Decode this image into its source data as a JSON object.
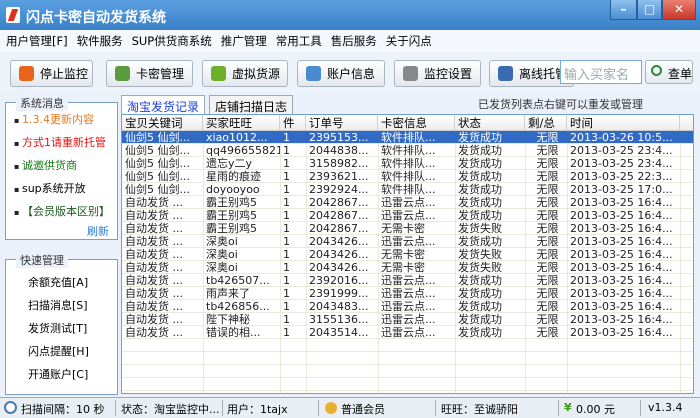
{
  "window": {
    "title": "闪点卡密自动发货系统",
    "min": "–",
    "max": "□",
    "close": "✕"
  },
  "menu": [
    "用户管理[F]",
    "软件服务",
    "SUP供货商系统",
    "推广管理",
    "常用工具",
    "售后服务",
    "关于闪点"
  ],
  "toolbar": [
    {
      "label": "停止监控",
      "icon": "stop-monitor-icon",
      "color": "#e8641a"
    },
    {
      "label": "卡密管理",
      "icon": "card-list-icon",
      "color": "#5a9a40"
    },
    {
      "label": "虚拟货源",
      "icon": "basket-icon",
      "color": "#6ab02a"
    },
    {
      "label": "账户信息",
      "icon": "info-icon",
      "color": "#4a8ad0"
    },
    {
      "label": "监控设置",
      "icon": "gear-icon",
      "color": "#888888"
    },
    {
      "label": "离线托管",
      "icon": "robot-icon",
      "color": "#3a6ab0"
    }
  ],
  "search": {
    "placeholder": "输入买家名",
    "button": "查单"
  },
  "system_messages": {
    "title": "系统消息",
    "items": [
      {
        "text": "1.3.4更新内容",
        "color": "#e87a20"
      },
      {
        "text": "方式1请重新托管",
        "color": "#e81010"
      },
      {
        "text": "诚邀供货商",
        "color": "#1a7a1a"
      },
      {
        "text": "sup系统开放",
        "color": "#000000"
      },
      {
        "text": "【会员版本区别】",
        "color": "#1a5a1a"
      }
    ],
    "refresh": "刷新"
  },
  "quick": {
    "title": "快速管理",
    "items": [
      "余额充值[A]",
      "扫描消息[S]",
      "发货测试[T]",
      "闪点提醒[H]",
      "开通账户[C]"
    ]
  },
  "tabs": [
    "淘宝发货记录",
    "店铺扫描日志"
  ],
  "hint": "已发货列表点右键可以重发或管理",
  "table": {
    "columns": [
      "宝贝关键词",
      "买家旺旺",
      "件",
      "订单号",
      "卡密信息",
      "状态",
      "剩/总",
      "时间"
    ],
    "rows": [
      [
        "仙剑5 仙剑...",
        "xiao1012...",
        "1",
        "2395153...",
        "软件排队...",
        "发货成功",
        "无限",
        "2013-03-26 10:5..."
      ],
      [
        "仙剑5 仙剑...",
        "qq496655821",
        "1",
        "2044838...",
        "软件排队...",
        "发货成功",
        "无限",
        "2013-03-25 23:4..."
      ],
      [
        "仙剑5 仙剑...",
        "遗忘y二y",
        "1",
        "3158982...",
        "软件排队...",
        "发货成功",
        "无限",
        "2013-03-25 23:4..."
      ],
      [
        "仙剑5 仙剑...",
        "星雨的痕迹",
        "1",
        "2393621...",
        "软件排队...",
        "发货成功",
        "无限",
        "2013-03-25 22:3..."
      ],
      [
        "仙剑5 仙剑...",
        "doyooyoo",
        "1",
        "2392924...",
        "软件排队...",
        "发货成功",
        "无限",
        "2013-03-25 17:0..."
      ],
      [
        "自动发货 ...",
        "霸王别鸡5",
        "1",
        "2042867...",
        "迅雷云点...",
        "发货成功",
        "无限",
        "2013-03-25 16:4..."
      ],
      [
        "自动发货 ...",
        "霸王别鸡5",
        "1",
        "2042867...",
        "迅雷云点...",
        "发货成功",
        "无限",
        "2013-03-25 16:4..."
      ],
      [
        "自动发货 ...",
        "霸王别鸡5",
        "1",
        "2042867...",
        "无需卡密",
        "发货失败",
        "无限",
        "2013-03-25 16:4..."
      ],
      [
        "自动发货 ...",
        "深奥oi",
        "1",
        "2043426...",
        "迅雷云点...",
        "发货成功",
        "无限",
        "2013-03-25 16:4..."
      ],
      [
        "自动发货 ...",
        "深奥oi",
        "1",
        "2043426...",
        "无需卡密",
        "发货失败",
        "无限",
        "2013-03-25 16:4..."
      ],
      [
        "自动发货 ...",
        "深奥oi",
        "1",
        "2043426...",
        "无需卡密",
        "发货失败",
        "无限",
        "2013-03-25 16:4..."
      ],
      [
        "自动发货 ...",
        "tb426507...",
        "1",
        "2392016...",
        "迅雷云点...",
        "发货成功",
        "无限",
        "2013-03-25 16:4..."
      ],
      [
        "自动发货 ...",
        "雨声来了",
        "1",
        "2391999...",
        "迅雷云点...",
        "发货成功",
        "无限",
        "2013-03-25 16:4..."
      ],
      [
        "自动发货 ...",
        "tb426856...",
        "1",
        "2043483...",
        "迅雷云点...",
        "发货成功",
        "无限",
        "2013-03-25 16:4..."
      ],
      [
        "自动发货 ...",
        "陛下神秘",
        "1",
        "3155136...",
        "迅雷云点...",
        "发货成功",
        "无限",
        "2013-03-25 16:4..."
      ],
      [
        "自动发货 ...",
        "错误的相...",
        "1",
        "2043514...",
        "迅雷云点...",
        "发货成功",
        "无限",
        "2013-03-25 16:4..."
      ]
    ]
  },
  "statusbar": {
    "interval": "扫描间隔：10 秒",
    "state": "状态：淘宝监控中...",
    "user": "用户：1tajx",
    "level": "普通会员",
    "wangwang": "旺旺：至诚骄阳",
    "balance": "0.00 元",
    "version": "v1.3.4"
  }
}
